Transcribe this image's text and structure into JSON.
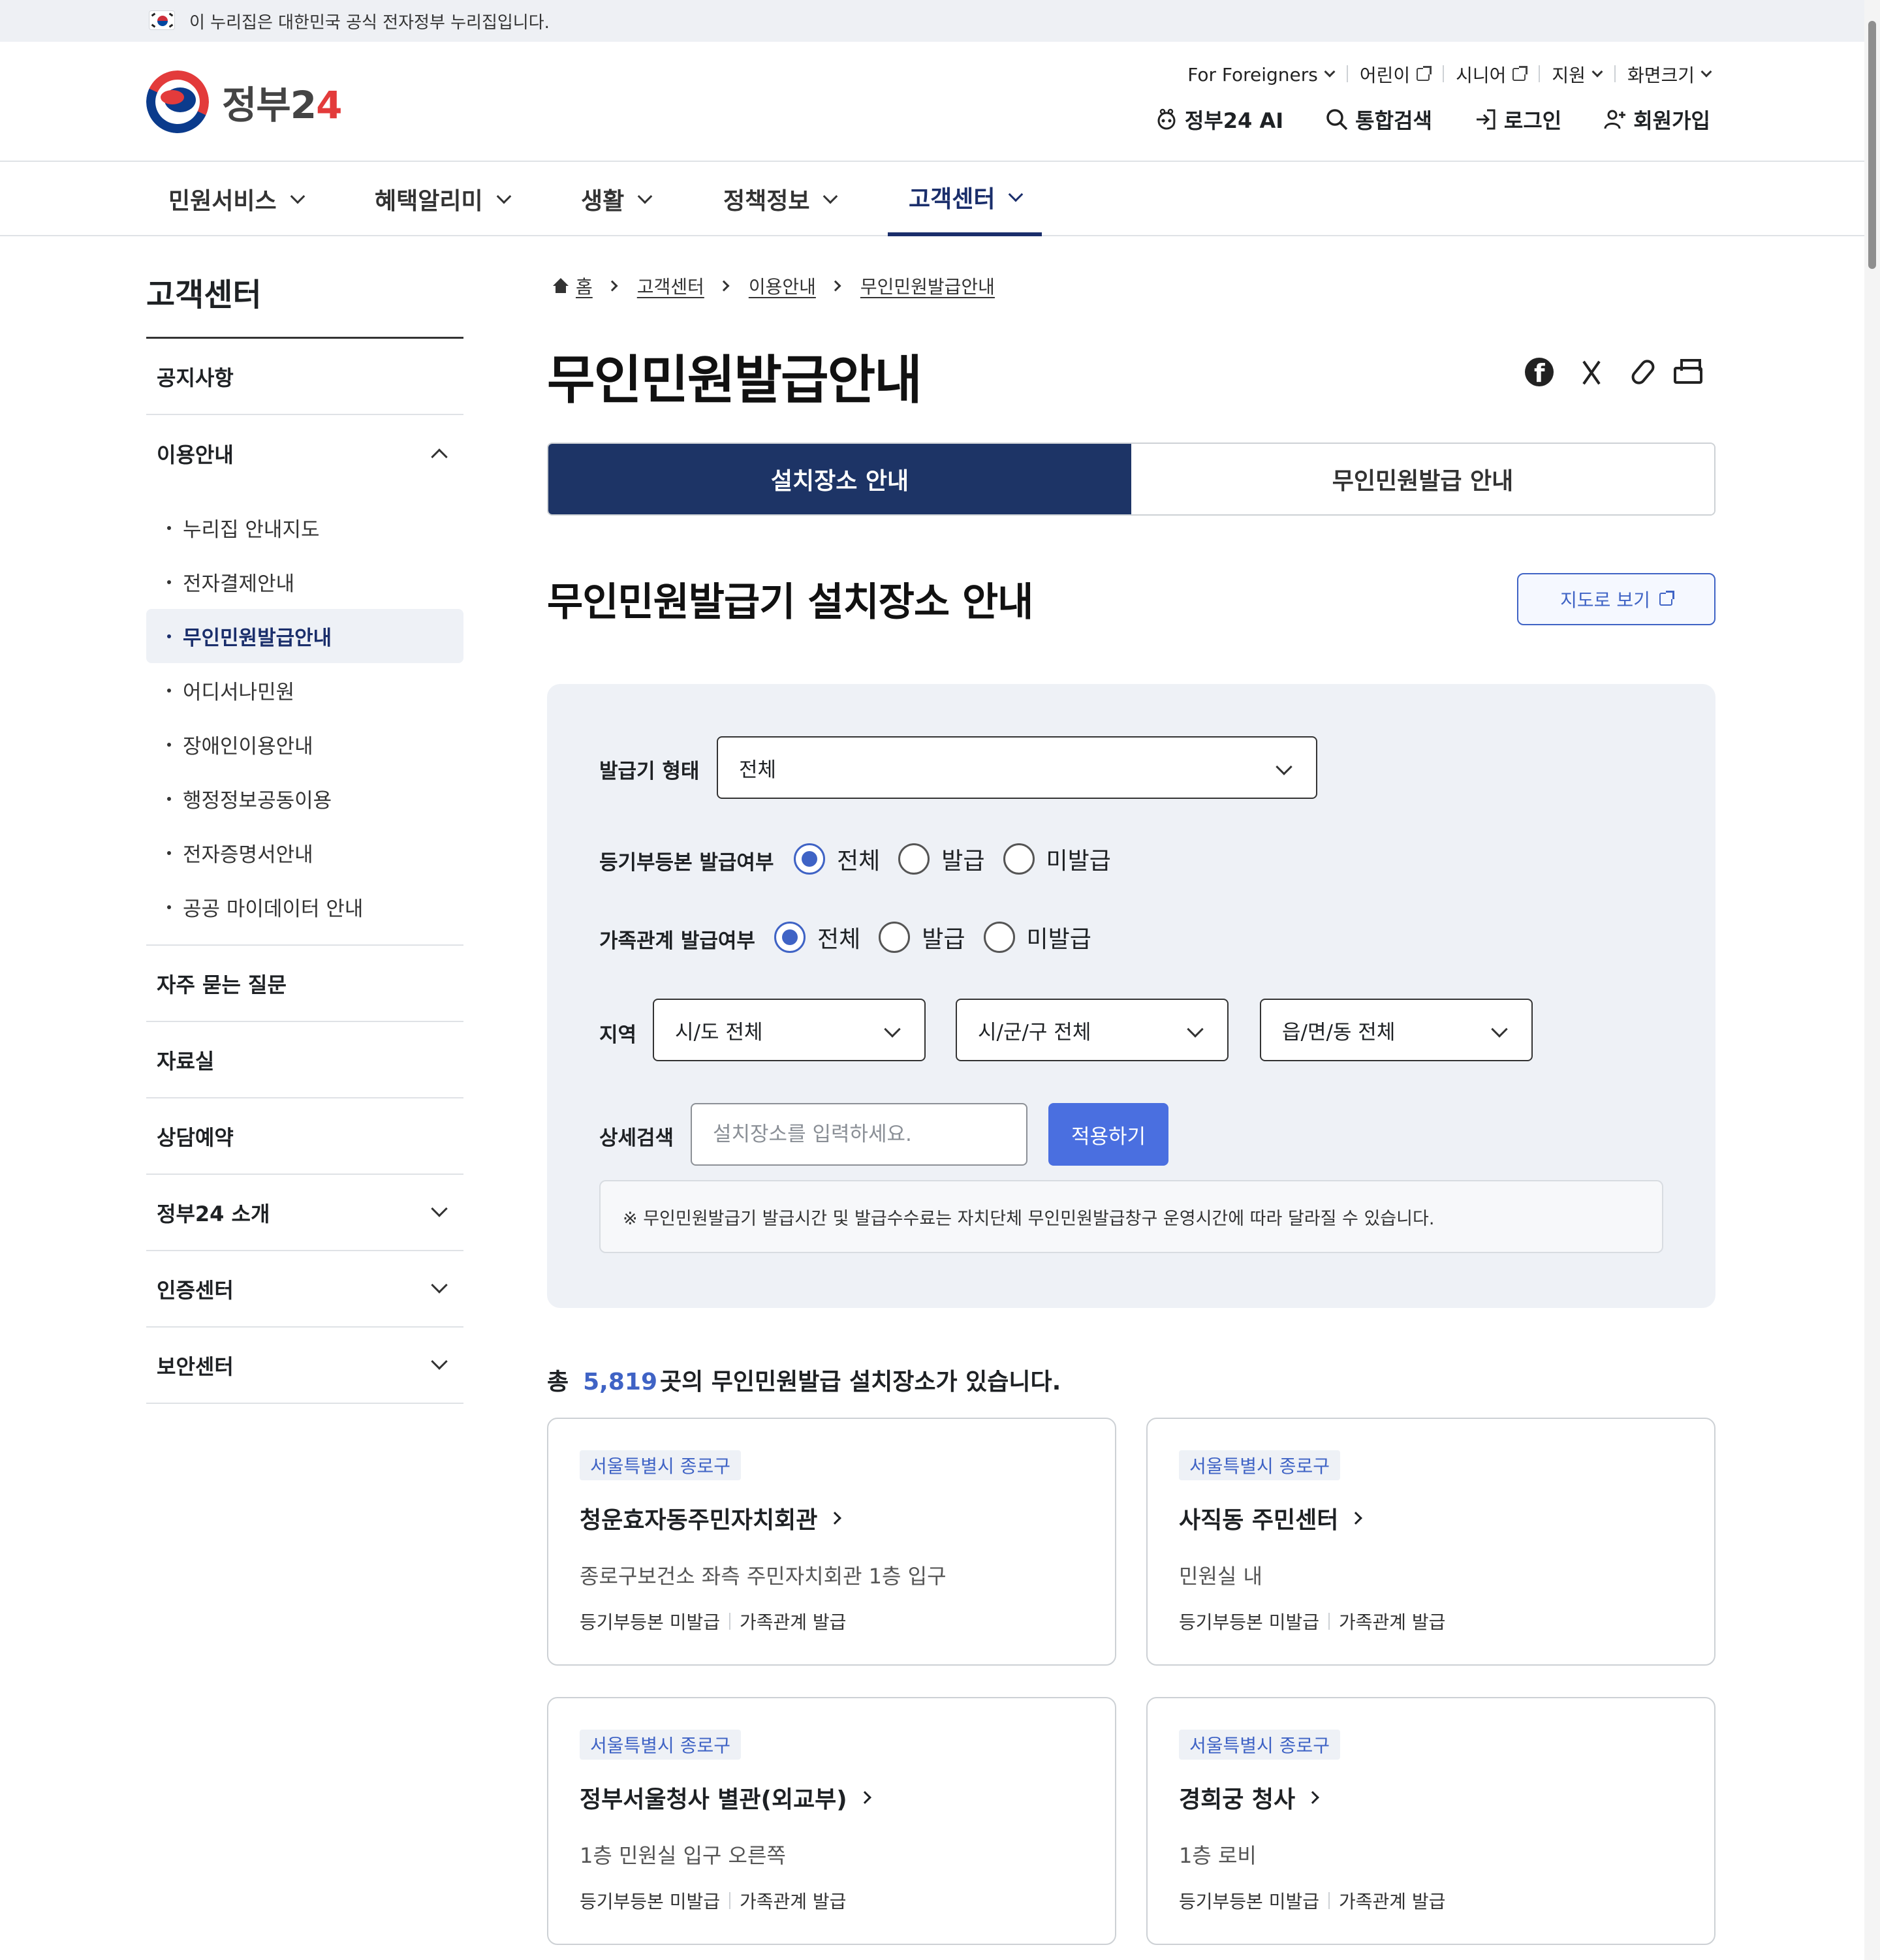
{
  "official_banner": {
    "text": "이 누리집은 대한민국 공식 전자정부 누리집입니다."
  },
  "logo": {
    "text": "정부2",
    "text_plus": "4"
  },
  "utility_links": [
    {
      "label": "For Foreigners",
      "icon": "chevron-down-icon"
    },
    {
      "label": "어린이",
      "icon": "external-link-icon"
    },
    {
      "label": "시니어",
      "icon": "external-link-icon"
    },
    {
      "label": "지원",
      "icon": "chevron-down-icon"
    },
    {
      "label": "화면크기",
      "icon": "chevron-down-icon"
    }
  ],
  "main_utility": [
    {
      "label": "정부24 AI",
      "icon": "ai-bot-icon"
    },
    {
      "label": "통합검색",
      "icon": "search-icon"
    },
    {
      "label": "로그인",
      "icon": "login-icon"
    },
    {
      "label": "회원가입",
      "icon": "user-add-icon"
    }
  ],
  "gnb": [
    {
      "label": "민원서비스"
    },
    {
      "label": "혜택알리미"
    },
    {
      "label": "생활"
    },
    {
      "label": "정책정보"
    },
    {
      "label": "고객센터",
      "active": true
    }
  ],
  "sidebar": {
    "title": "고객센터",
    "items": [
      {
        "label": "공지사항"
      },
      {
        "label": "이용안내",
        "expanded": true,
        "children": [
          {
            "label": "누리집 안내지도"
          },
          {
            "label": "전자결제안내"
          },
          {
            "label": "무인민원발급안내",
            "active": true
          },
          {
            "label": "어디서나민원"
          },
          {
            "label": "장애인이용안내"
          },
          {
            "label": "행정정보공동이용"
          },
          {
            "label": "전자증명서안내"
          },
          {
            "label": "공공 마이데이터 안내"
          }
        ]
      },
      {
        "label": "자주 묻는 질문"
      },
      {
        "label": "자료실"
      },
      {
        "label": "상담예약"
      },
      {
        "label": "정부24 소개",
        "expandable": true
      },
      {
        "label": "인증센터",
        "expandable": true
      },
      {
        "label": "보안센터",
        "expandable": true
      }
    ]
  },
  "breadcrumb": [
    "홈",
    "고객센터",
    "이용안내",
    "무인민원발급안내"
  ],
  "page_title": "무인민원발급안내",
  "share_icons": [
    "facebook-icon",
    "x-icon",
    "link-icon",
    "print-icon"
  ],
  "tabs": [
    {
      "label": "설치장소 안내",
      "active": true
    },
    {
      "label": "무인민원발급 안내"
    }
  ],
  "section_title": "무인민원발급기 설치장소 안내",
  "map_button": {
    "label": "지도로 보기"
  },
  "filter": {
    "kiosk_type": {
      "label": "발급기 형태",
      "value": "전체"
    },
    "registry": {
      "label": "등기부등본 발급여부",
      "options": [
        "전체",
        "발급",
        "미발급"
      ],
      "selected": "전체"
    },
    "family": {
      "label": "가족관계 발급여부",
      "options": [
        "전체",
        "발급",
        "미발급"
      ],
      "selected": "전체"
    },
    "region": {
      "label": "지역",
      "sido": "시/도 전체",
      "sigungu": "시/군/구 전체",
      "dong": "읍/면/동 전체"
    },
    "detail": {
      "label": "상세검색",
      "placeholder": "설치장소를 입력하세요.",
      "value": ""
    },
    "apply_label": "적용하기",
    "notice": "※ 무인민원발급기 발급시간 및 발급수수료는 자치단체 무인민원발급창구 운영시간에 따라 달라질 수 있습니다."
  },
  "total": {
    "prefix": "총",
    "count": "5,819",
    "suffix": "곳의 무인민원발급 설치장소가 있습니다."
  },
  "cards": [
    {
      "region": "서울특별시 종로구",
      "name": "청운효자동주민자치회관",
      "location": "종로구보건소 좌측 주민자치회관 1층 입구",
      "registry": "등기부등본 미발급",
      "family": "가족관계 발급"
    },
    {
      "region": "서울특별시 종로구",
      "name": "사직동 주민센터",
      "location": "민원실 내",
      "registry": "등기부등본 미발급",
      "family": "가족관계 발급"
    },
    {
      "region": "서울특별시 종로구",
      "name": "정부서울청사 별관(외교부)",
      "location": "1층 민원실 입구 오른쪽",
      "registry": "등기부등본 미발급",
      "family": "가족관계 발급"
    },
    {
      "region": "서울특별시 종로구",
      "name": "경희궁 청사",
      "location": "1층 로비",
      "registry": "등기부등본 미발급",
      "family": "가족관계 발급"
    }
  ]
}
